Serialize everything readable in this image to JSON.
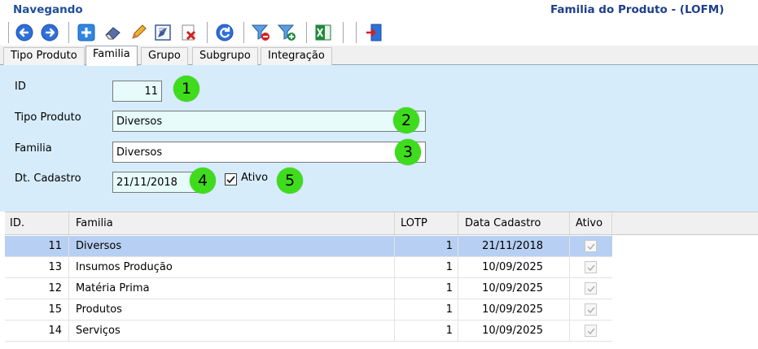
{
  "header": {
    "status": "Navegando",
    "title": "Familia do Produto - (LOFM)"
  },
  "toolbar": {
    "colors": {
      "blue": "#2f6fd8",
      "red": "#d32020",
      "green": "#1e8a3a"
    },
    "buttons": [
      {
        "icon": "arrow-left-icon"
      },
      {
        "icon": "arrow-right-icon"
      },
      {
        "icon": "plus-icon"
      },
      {
        "icon": "eraser-icon"
      },
      {
        "icon": "pencil-icon"
      },
      {
        "icon": "save-icon"
      },
      {
        "icon": "delete-icon"
      },
      {
        "icon": "refresh-icon"
      },
      {
        "icon": "filter-remove-icon"
      },
      {
        "icon": "filter-add-icon"
      },
      {
        "icon": "excel-icon"
      },
      {
        "icon": "exit-icon"
      }
    ]
  },
  "tabs": [
    "Tipo Produto",
    "Familia",
    "Grupo",
    "Subgrupo",
    "Integração"
  ],
  "active_tab": "Familia",
  "form": {
    "id_label": "ID",
    "id_value": "11",
    "tipo_label": "Tipo Produto",
    "tipo_value": "Diversos",
    "familia_label": "Familia",
    "familia_value": "Diversos",
    "dt_label": "Dt. Cadastro",
    "dt_value": "21/11/2018",
    "ativo_label": "Ativo",
    "badges": [
      "1",
      "2",
      "3",
      "4",
      "5"
    ]
  },
  "grid": {
    "columns": [
      "ID.",
      "Familia",
      "LOTP",
      "Data Cadastro",
      "Ativo"
    ],
    "rows": [
      {
        "id": "11",
        "familia": "Diversos",
        "lotp": "1",
        "data": "21/11/2018",
        "ativo": true
      },
      {
        "id": "13",
        "familia": "Insumos Produção",
        "lotp": "1",
        "data": "10/09/2025",
        "ativo": true
      },
      {
        "id": "12",
        "familia": "Matéria Prima",
        "lotp": "1",
        "data": "10/09/2025",
        "ativo": true
      },
      {
        "id": "15",
        "familia": "Produtos",
        "lotp": "1",
        "data": "10/09/2025",
        "ativo": true
      },
      {
        "id": "14",
        "familia": "Serviços",
        "lotp": "1",
        "data": "10/09/2025",
        "ativo": true
      }
    ]
  }
}
